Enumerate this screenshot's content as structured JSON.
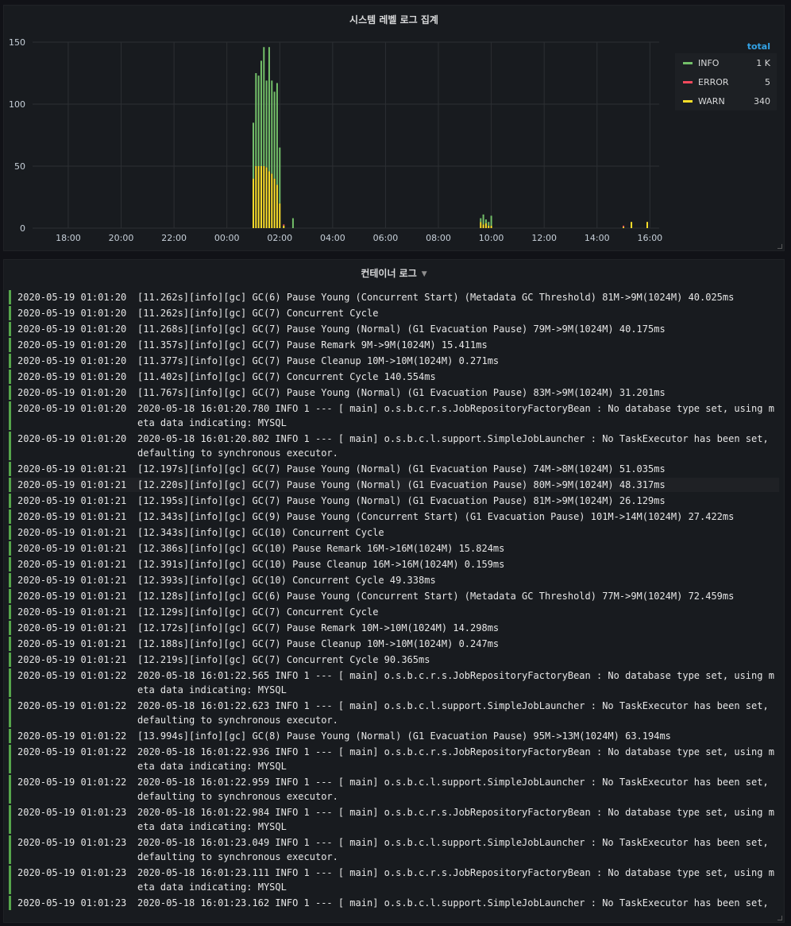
{
  "chart_panel": {
    "title": "시스템 레벨 로그 집계",
    "legend": {
      "header": "total",
      "items": [
        {
          "name": "INFO",
          "value": "1 K",
          "color": "#73bf69"
        },
        {
          "name": "ERROR",
          "value": "5",
          "color": "#f2495c"
        },
        {
          "name": "WARN",
          "value": "340",
          "color": "#fade2a"
        }
      ]
    }
  },
  "chart_data": {
    "type": "bar",
    "stacked": true,
    "x_tick_labels": [
      "18:00",
      "20:00",
      "22:00",
      "00:00",
      "02:00",
      "04:00",
      "06:00",
      "08:00",
      "10:00",
      "12:00",
      "14:00",
      "16:00"
    ],
    "y_tick_labels": [
      "0",
      "50",
      "100",
      "150"
    ],
    "ylim": [
      0,
      150
    ],
    "xlim_hours": [
      16.65,
      40.35
    ],
    "grid": true,
    "series": [
      {
        "name": "INFO",
        "color": "#73bf69",
        "points": [
          {
            "x": 25.0,
            "y": 45
          },
          {
            "x": 25.1,
            "y": 75
          },
          {
            "x": 25.2,
            "y": 73
          },
          {
            "x": 25.3,
            "y": 85
          },
          {
            "x": 25.4,
            "y": 96
          },
          {
            "x": 25.5,
            "y": 70
          },
          {
            "x": 25.6,
            "y": 100
          },
          {
            "x": 25.7,
            "y": 75
          },
          {
            "x": 25.8,
            "y": 70
          },
          {
            "x": 25.9,
            "y": 82
          },
          {
            "x": 26.0,
            "y": 45
          },
          {
            "x": 26.15,
            "y": 0
          },
          {
            "x": 26.5,
            "y": 8
          },
          {
            "x": 33.6,
            "y": 3
          },
          {
            "x": 33.7,
            "y": 8
          },
          {
            "x": 33.8,
            "y": 3
          },
          {
            "x": 33.9,
            "y": 3
          },
          {
            "x": 34.0,
            "y": 8
          },
          {
            "x": 39.0,
            "y": 0
          },
          {
            "x": 39.3,
            "y": 0
          },
          {
            "x": 39.9,
            "y": 0
          }
        ]
      },
      {
        "name": "ERROR",
        "color": "#f2495c",
        "points": [
          {
            "x": 26.15,
            "y": 1
          },
          {
            "x": 39.0,
            "y": 1
          }
        ]
      },
      {
        "name": "WARN",
        "color": "#fade2a",
        "points": [
          {
            "x": 25.0,
            "y": 40
          },
          {
            "x": 25.1,
            "y": 50
          },
          {
            "x": 25.2,
            "y": 50
          },
          {
            "x": 25.3,
            "y": 50
          },
          {
            "x": 25.4,
            "y": 50
          },
          {
            "x": 25.5,
            "y": 49
          },
          {
            "x": 25.6,
            "y": 46
          },
          {
            "x": 25.7,
            "y": 44
          },
          {
            "x": 25.8,
            "y": 40
          },
          {
            "x": 25.9,
            "y": 35
          },
          {
            "x": 26.0,
            "y": 20
          },
          {
            "x": 26.15,
            "y": 2
          },
          {
            "x": 33.6,
            "y": 5
          },
          {
            "x": 33.7,
            "y": 3
          },
          {
            "x": 33.8,
            "y": 4
          },
          {
            "x": 33.9,
            "y": 2
          },
          {
            "x": 34.0,
            "y": 2
          },
          {
            "x": 39.0,
            "y": 1
          },
          {
            "x": 39.3,
            "y": 5
          },
          {
            "x": 39.9,
            "y": 5
          }
        ]
      }
    ]
  },
  "logs_panel": {
    "title": "컨테이너 로그",
    "rows": [
      {
        "ts": "2020-05-19 01:01:20",
        "msg": "[11.262s][info][gc] GC(6) Pause Young (Concurrent Start) (Metadata GC Threshold) 81M->9M(1024M) 40.025ms"
      },
      {
        "ts": "2020-05-19 01:01:20",
        "msg": "[11.262s][info][gc] GC(7) Concurrent Cycle"
      },
      {
        "ts": "2020-05-19 01:01:20",
        "msg": "[11.268s][info][gc] GC(7) Pause Young (Normal) (G1 Evacuation Pause) 79M->9M(1024M) 40.175ms"
      },
      {
        "ts": "2020-05-19 01:01:20",
        "msg": "[11.357s][info][gc] GC(7) Pause Remark 9M->9M(1024M) 15.411ms"
      },
      {
        "ts": "2020-05-19 01:01:20",
        "msg": "[11.377s][info][gc] GC(7) Pause Cleanup 10M->10M(1024M) 0.271ms"
      },
      {
        "ts": "2020-05-19 01:01:20",
        "msg": "[11.402s][info][gc] GC(7) Concurrent Cycle 140.554ms"
      },
      {
        "ts": "2020-05-19 01:01:20",
        "msg": "[11.767s][info][gc] GC(7) Pause Young (Normal) (G1 Evacuation Pause) 83M->9M(1024M) 31.201ms"
      },
      {
        "ts": "2020-05-19 01:01:20",
        "msg": "2020-05-18 16:01:20.780 INFO 1 --- [ main] o.s.b.c.r.s.JobRepositoryFactoryBean : No database type set, using meta data indicating: MYSQL"
      },
      {
        "ts": "2020-05-19 01:01:20",
        "msg": "2020-05-18 16:01:20.802 INFO 1 --- [ main] o.s.b.c.l.support.SimpleJobLauncher : No TaskExecutor has been set, defaulting to synchronous executor."
      },
      {
        "ts": "2020-05-19 01:01:21",
        "msg": "[12.197s][info][gc] GC(7) Pause Young (Normal) (G1 Evacuation Pause) 74M->8M(1024M) 51.035ms"
      },
      {
        "ts": "2020-05-19 01:01:21",
        "msg": "[12.220s][info][gc] GC(7) Pause Young (Normal) (G1 Evacuation Pause) 80M->9M(1024M) 48.317ms",
        "highlight": true
      },
      {
        "ts": "2020-05-19 01:01:21",
        "msg": "[12.195s][info][gc] GC(7) Pause Young (Normal) (G1 Evacuation Pause) 81M->9M(1024M) 26.129ms"
      },
      {
        "ts": "2020-05-19 01:01:21",
        "msg": "[12.343s][info][gc] GC(9) Pause Young (Concurrent Start) (G1 Evacuation Pause) 101M->14M(1024M) 27.422ms"
      },
      {
        "ts": "2020-05-19 01:01:21",
        "msg": "[12.343s][info][gc] GC(10) Concurrent Cycle"
      },
      {
        "ts": "2020-05-19 01:01:21",
        "msg": "[12.386s][info][gc] GC(10) Pause Remark 16M->16M(1024M) 15.824ms"
      },
      {
        "ts": "2020-05-19 01:01:21",
        "msg": "[12.391s][info][gc] GC(10) Pause Cleanup 16M->16M(1024M) 0.159ms"
      },
      {
        "ts": "2020-05-19 01:01:21",
        "msg": "[12.393s][info][gc] GC(10) Concurrent Cycle 49.338ms"
      },
      {
        "ts": "2020-05-19 01:01:21",
        "msg": "[12.128s][info][gc] GC(6) Pause Young (Concurrent Start) (Metadata GC Threshold) 77M->9M(1024M) 72.459ms"
      },
      {
        "ts": "2020-05-19 01:01:21",
        "msg": "[12.129s][info][gc] GC(7) Concurrent Cycle"
      },
      {
        "ts": "2020-05-19 01:01:21",
        "msg": "[12.172s][info][gc] GC(7) Pause Remark 10M->10M(1024M) 14.298ms"
      },
      {
        "ts": "2020-05-19 01:01:21",
        "msg": "[12.188s][info][gc] GC(7) Pause Cleanup 10M->10M(1024M) 0.247ms"
      },
      {
        "ts": "2020-05-19 01:01:21",
        "msg": "[12.219s][info][gc] GC(7) Concurrent Cycle 90.365ms"
      },
      {
        "ts": "2020-05-19 01:01:22",
        "msg": "2020-05-18 16:01:22.565 INFO 1 --- [ main] o.s.b.c.r.s.JobRepositoryFactoryBean : No database type set, using meta data indicating: MYSQL"
      },
      {
        "ts": "2020-05-19 01:01:22",
        "msg": "2020-05-18 16:01:22.623 INFO 1 --- [ main] o.s.b.c.l.support.SimpleJobLauncher : No TaskExecutor has been set, defaulting to synchronous executor."
      },
      {
        "ts": "2020-05-19 01:01:22",
        "msg": "[13.994s][info][gc] GC(8) Pause Young (Normal) (G1 Evacuation Pause) 95M->13M(1024M) 63.194ms"
      },
      {
        "ts": "2020-05-19 01:01:22",
        "msg": "2020-05-18 16:01:22.936 INFO 1 --- [ main] o.s.b.c.r.s.JobRepositoryFactoryBean : No database type set, using meta data indicating: MYSQL"
      },
      {
        "ts": "2020-05-19 01:01:22",
        "msg": "2020-05-18 16:01:22.959 INFO 1 --- [ main] o.s.b.c.l.support.SimpleJobLauncher : No TaskExecutor has been set, defaulting to synchronous executor."
      },
      {
        "ts": "2020-05-19 01:01:23",
        "msg": "2020-05-18 16:01:22.984 INFO 1 --- [ main] o.s.b.c.r.s.JobRepositoryFactoryBean : No database type set, using meta data indicating: MYSQL"
      },
      {
        "ts": "2020-05-19 01:01:23",
        "msg": "2020-05-18 16:01:23.049 INFO 1 --- [ main] o.s.b.c.l.support.SimpleJobLauncher : No TaskExecutor has been set, defaulting to synchronous executor."
      },
      {
        "ts": "2020-05-19 01:01:23",
        "msg": "2020-05-18 16:01:23.111 INFO 1 --- [ main] o.s.b.c.r.s.JobRepositoryFactoryBean : No database type set, using meta data indicating: MYSQL"
      },
      {
        "ts": "2020-05-19 01:01:23",
        "msg": "2020-05-18 16:01:23.162 INFO 1 --- [ main] o.s.b.c.l.support.SimpleJobLauncher : No TaskExecutor has been set,"
      }
    ]
  }
}
